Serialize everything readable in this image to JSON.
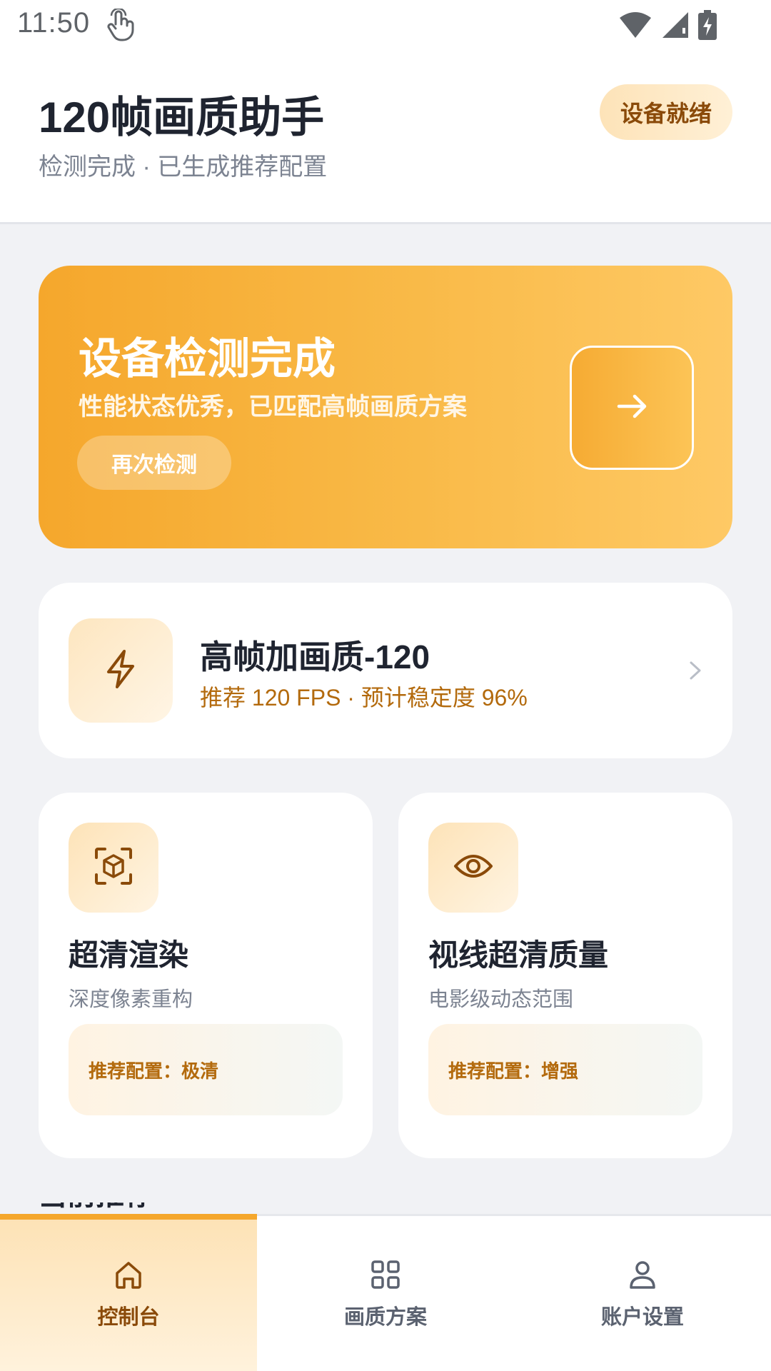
{
  "status_bar": {
    "time": "11:50",
    "icons": [
      "touch-gesture-icon",
      "wifi-icon",
      "signal-icon",
      "battery-charging-icon"
    ]
  },
  "header": {
    "title": "120帧画质助手",
    "subtitle": "检测完成 · 已生成推荐配置",
    "status_badge": "设备就绪"
  },
  "hero": {
    "title": "设备检测完成",
    "description": "性能状态优秀，已匹配高帧画质方案",
    "recheck_label": "再次检测",
    "arrow_icon": "arrow-right-icon"
  },
  "recommendation": {
    "title": "高帧加画质-120",
    "subtitle": "推荐 120 FPS · 预计稳定度 96%",
    "icon": "lightning-icon"
  },
  "features": [
    {
      "title": "超清渲染",
      "description": "深度像素重构",
      "tag": "推荐配置：极清",
      "icon": "cube-scan-icon"
    },
    {
      "title": "视线超清质量",
      "description": "电影级动态范围",
      "tag": "推荐配置：增强",
      "icon": "eye-icon"
    }
  ],
  "section_peek": "当前推荐",
  "bottom_nav": [
    {
      "label": "控制台",
      "icon": "home-icon",
      "active": true
    },
    {
      "label": "画质方案",
      "icon": "grid-icon",
      "active": false
    },
    {
      "label": "账户设置",
      "icon": "user-icon",
      "active": false
    }
  ],
  "colors": {
    "accent": "#f5a72c",
    "accent_dark": "#8a4a09",
    "accent_text": "#b36a0d",
    "background": "#f1f2f5"
  }
}
